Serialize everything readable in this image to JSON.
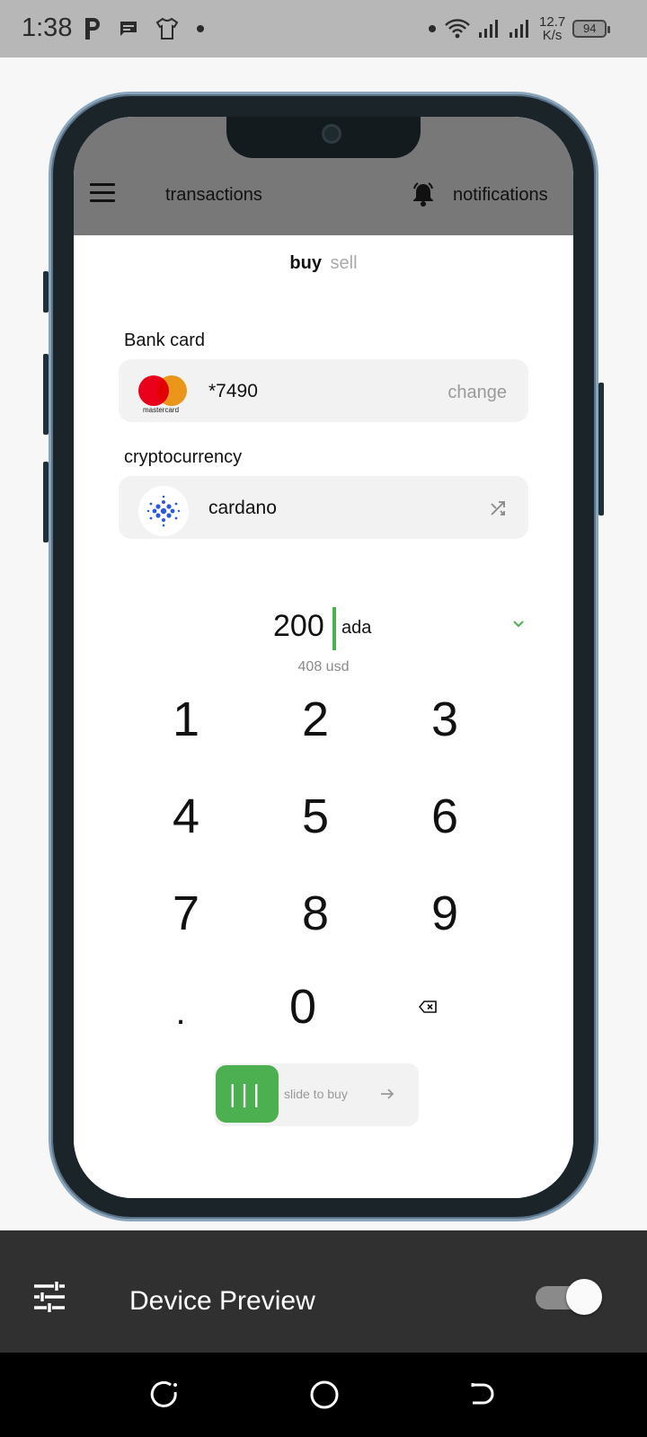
{
  "status_bar": {
    "time": "1:38",
    "speed_value": "12.7",
    "speed_unit": "K/s",
    "battery": "94"
  },
  "app_bar": {
    "title": "transactions",
    "notifications_label": "notifications"
  },
  "tabs": {
    "buy": "buy",
    "sell": "sell",
    "active": "buy"
  },
  "bank_card": {
    "label": "Bank card",
    "brand_text": "mastercard",
    "number": "*7490",
    "change_label": "change"
  },
  "crypto": {
    "label": "cryptocurrency",
    "coin": "cardano"
  },
  "amount": {
    "value": "200",
    "unit": "ada",
    "fiat": "408 usd"
  },
  "keypad": {
    "keys": [
      "1",
      "2",
      "3",
      "4",
      "5",
      "6",
      "7",
      "8",
      "9",
      ".",
      "0"
    ]
  },
  "slider": {
    "knob": "|||",
    "label": "slide to buy"
  },
  "device_preview": {
    "title": "Device Preview",
    "toggle_on": true
  },
  "colors": {
    "accent": "#4caf50",
    "app_bar": "#787878",
    "preview_bar": "#303030"
  }
}
